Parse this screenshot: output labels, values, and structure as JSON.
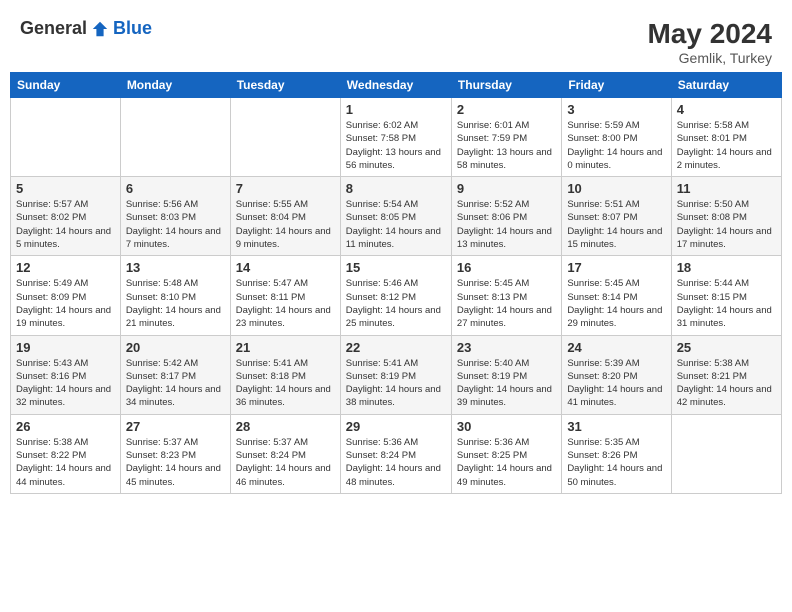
{
  "header": {
    "logo_general": "General",
    "logo_blue": "Blue",
    "month_year": "May 2024",
    "location": "Gemlik, Turkey"
  },
  "weekdays": [
    "Sunday",
    "Monday",
    "Tuesday",
    "Wednesday",
    "Thursday",
    "Friday",
    "Saturday"
  ],
  "weeks": [
    [
      {
        "day": "",
        "sunrise": "",
        "sunset": "",
        "daylight": ""
      },
      {
        "day": "",
        "sunrise": "",
        "sunset": "",
        "daylight": ""
      },
      {
        "day": "",
        "sunrise": "",
        "sunset": "",
        "daylight": ""
      },
      {
        "day": "1",
        "sunrise": "Sunrise: 6:02 AM",
        "sunset": "Sunset: 7:58 PM",
        "daylight": "Daylight: 13 hours and 56 minutes."
      },
      {
        "day": "2",
        "sunrise": "Sunrise: 6:01 AM",
        "sunset": "Sunset: 7:59 PM",
        "daylight": "Daylight: 13 hours and 58 minutes."
      },
      {
        "day": "3",
        "sunrise": "Sunrise: 5:59 AM",
        "sunset": "Sunset: 8:00 PM",
        "daylight": "Daylight: 14 hours and 0 minutes."
      },
      {
        "day": "4",
        "sunrise": "Sunrise: 5:58 AM",
        "sunset": "Sunset: 8:01 PM",
        "daylight": "Daylight: 14 hours and 2 minutes."
      }
    ],
    [
      {
        "day": "5",
        "sunrise": "Sunrise: 5:57 AM",
        "sunset": "Sunset: 8:02 PM",
        "daylight": "Daylight: 14 hours and 5 minutes."
      },
      {
        "day": "6",
        "sunrise": "Sunrise: 5:56 AM",
        "sunset": "Sunset: 8:03 PM",
        "daylight": "Daylight: 14 hours and 7 minutes."
      },
      {
        "day": "7",
        "sunrise": "Sunrise: 5:55 AM",
        "sunset": "Sunset: 8:04 PM",
        "daylight": "Daylight: 14 hours and 9 minutes."
      },
      {
        "day": "8",
        "sunrise": "Sunrise: 5:54 AM",
        "sunset": "Sunset: 8:05 PM",
        "daylight": "Daylight: 14 hours and 11 minutes."
      },
      {
        "day": "9",
        "sunrise": "Sunrise: 5:52 AM",
        "sunset": "Sunset: 8:06 PM",
        "daylight": "Daylight: 14 hours and 13 minutes."
      },
      {
        "day": "10",
        "sunrise": "Sunrise: 5:51 AM",
        "sunset": "Sunset: 8:07 PM",
        "daylight": "Daylight: 14 hours and 15 minutes."
      },
      {
        "day": "11",
        "sunrise": "Sunrise: 5:50 AM",
        "sunset": "Sunset: 8:08 PM",
        "daylight": "Daylight: 14 hours and 17 minutes."
      }
    ],
    [
      {
        "day": "12",
        "sunrise": "Sunrise: 5:49 AM",
        "sunset": "Sunset: 8:09 PM",
        "daylight": "Daylight: 14 hours and 19 minutes."
      },
      {
        "day": "13",
        "sunrise": "Sunrise: 5:48 AM",
        "sunset": "Sunset: 8:10 PM",
        "daylight": "Daylight: 14 hours and 21 minutes."
      },
      {
        "day": "14",
        "sunrise": "Sunrise: 5:47 AM",
        "sunset": "Sunset: 8:11 PM",
        "daylight": "Daylight: 14 hours and 23 minutes."
      },
      {
        "day": "15",
        "sunrise": "Sunrise: 5:46 AM",
        "sunset": "Sunset: 8:12 PM",
        "daylight": "Daylight: 14 hours and 25 minutes."
      },
      {
        "day": "16",
        "sunrise": "Sunrise: 5:45 AM",
        "sunset": "Sunset: 8:13 PM",
        "daylight": "Daylight: 14 hours and 27 minutes."
      },
      {
        "day": "17",
        "sunrise": "Sunrise: 5:45 AM",
        "sunset": "Sunset: 8:14 PM",
        "daylight": "Daylight: 14 hours and 29 minutes."
      },
      {
        "day": "18",
        "sunrise": "Sunrise: 5:44 AM",
        "sunset": "Sunset: 8:15 PM",
        "daylight": "Daylight: 14 hours and 31 minutes."
      }
    ],
    [
      {
        "day": "19",
        "sunrise": "Sunrise: 5:43 AM",
        "sunset": "Sunset: 8:16 PM",
        "daylight": "Daylight: 14 hours and 32 minutes."
      },
      {
        "day": "20",
        "sunrise": "Sunrise: 5:42 AM",
        "sunset": "Sunset: 8:17 PM",
        "daylight": "Daylight: 14 hours and 34 minutes."
      },
      {
        "day": "21",
        "sunrise": "Sunrise: 5:41 AM",
        "sunset": "Sunset: 8:18 PM",
        "daylight": "Daylight: 14 hours and 36 minutes."
      },
      {
        "day": "22",
        "sunrise": "Sunrise: 5:41 AM",
        "sunset": "Sunset: 8:19 PM",
        "daylight": "Daylight: 14 hours and 38 minutes."
      },
      {
        "day": "23",
        "sunrise": "Sunrise: 5:40 AM",
        "sunset": "Sunset: 8:19 PM",
        "daylight": "Daylight: 14 hours and 39 minutes."
      },
      {
        "day": "24",
        "sunrise": "Sunrise: 5:39 AM",
        "sunset": "Sunset: 8:20 PM",
        "daylight": "Daylight: 14 hours and 41 minutes."
      },
      {
        "day": "25",
        "sunrise": "Sunrise: 5:38 AM",
        "sunset": "Sunset: 8:21 PM",
        "daylight": "Daylight: 14 hours and 42 minutes."
      }
    ],
    [
      {
        "day": "26",
        "sunrise": "Sunrise: 5:38 AM",
        "sunset": "Sunset: 8:22 PM",
        "daylight": "Daylight: 14 hours and 44 minutes."
      },
      {
        "day": "27",
        "sunrise": "Sunrise: 5:37 AM",
        "sunset": "Sunset: 8:23 PM",
        "daylight": "Daylight: 14 hours and 45 minutes."
      },
      {
        "day": "28",
        "sunrise": "Sunrise: 5:37 AM",
        "sunset": "Sunset: 8:24 PM",
        "daylight": "Daylight: 14 hours and 46 minutes."
      },
      {
        "day": "29",
        "sunrise": "Sunrise: 5:36 AM",
        "sunset": "Sunset: 8:24 PM",
        "daylight": "Daylight: 14 hours and 48 minutes."
      },
      {
        "day": "30",
        "sunrise": "Sunrise: 5:36 AM",
        "sunset": "Sunset: 8:25 PM",
        "daylight": "Daylight: 14 hours and 49 minutes."
      },
      {
        "day": "31",
        "sunrise": "Sunrise: 5:35 AM",
        "sunset": "Sunset: 8:26 PM",
        "daylight": "Daylight: 14 hours and 50 minutes."
      },
      {
        "day": "",
        "sunrise": "",
        "sunset": "",
        "daylight": ""
      }
    ]
  ]
}
